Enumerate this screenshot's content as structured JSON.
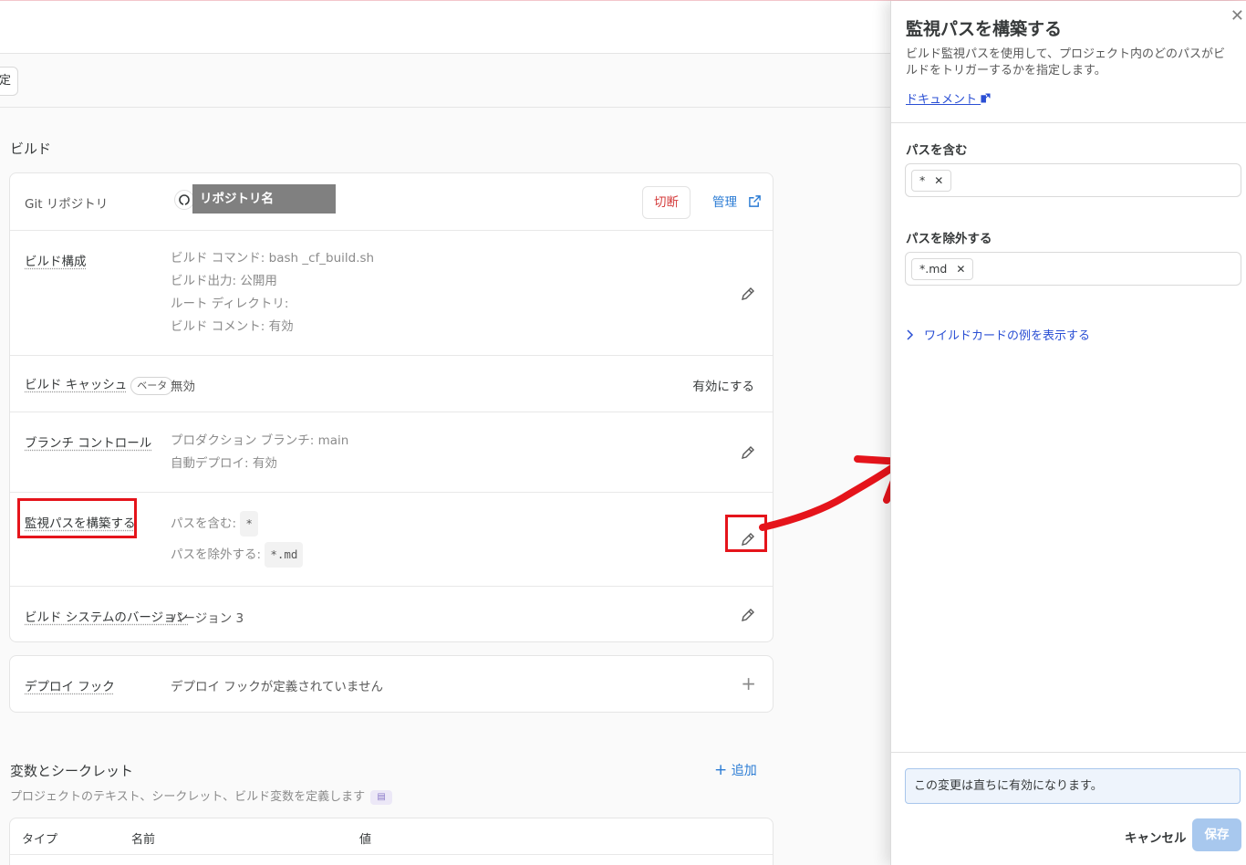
{
  "subnav": {
    "button_label": "定"
  },
  "build": {
    "section_title": "ビルド",
    "repo": {
      "label": "Git リポジトリ",
      "name": "リポジトリ名",
      "disconnect": "切断",
      "manage": "管理"
    },
    "config": {
      "label": "ビルド構成",
      "lines": [
        "ビルド コマンド: bash _cf_build.sh",
        "ビルド出力: 公開用",
        "ルート ディレクトリ:",
        "ビルド コメント: 有効"
      ]
    },
    "cache": {
      "label": "ビルド キャッシュ",
      "badge": "ベータ",
      "value": "無効",
      "action": "有効にする"
    },
    "branch": {
      "label": "ブランチ コントロール",
      "lines": [
        "プロダクション ブランチ: main",
        "自動デプロイ: 有効"
      ]
    },
    "watch": {
      "label": "監視パスを構築する",
      "include_label": "パスを含む:",
      "include_value": "*",
      "exclude_label": "パスを除外する:",
      "exclude_value": "*.md"
    },
    "system": {
      "label": "ビルド システムのバージョン",
      "value": "バージョン 3"
    },
    "hook": {
      "label": "デプロイ フック",
      "value": "デプロイ フックが定義されていません"
    }
  },
  "vars": {
    "title": "変数とシークレット",
    "description": "プロジェクトのテキスト、シークレット、ビルド変数を定義します",
    "add": "追加",
    "columns": [
      "タイプ",
      "名前",
      "値"
    ]
  },
  "panel": {
    "title": "監視パスを構築する",
    "description": "ビルド監視パスを使用して、プロジェクト内のどのパスがビルドをトリガーするかを指定します。",
    "doc_link": "ドキュメント",
    "include_label": "パスを含む",
    "include_chip": "*",
    "exclude_label": "パスを除外する",
    "exclude_chip": "*.md",
    "wildcard_link": "ワイルドカードの例を表示する",
    "notice": "この変更は直ちに有効になります。",
    "cancel": "キャンセル",
    "save": "保存"
  },
  "colors": {
    "accent": "#2a7bd4",
    "danger": "#d43b3b",
    "highlight": "#e5141b"
  }
}
